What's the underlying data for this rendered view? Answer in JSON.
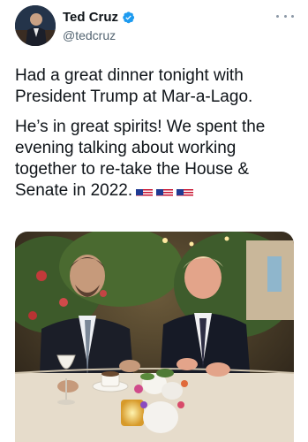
{
  "author": {
    "display_name": "Ted Cruz",
    "handle": "@tedcruz",
    "verified": true
  },
  "tweet": {
    "paragraph_1": "Had a great dinner tonight with President Trump at Mar-a-Lago.",
    "paragraph_2": "He’s in great spirits! We spent the evening talking about working together to re-take the House & Senate in 2022.",
    "emoji_flags": [
      "us-flag",
      "us-flag",
      "us-flag"
    ]
  },
  "icons": {
    "verified": "verified-badge-icon",
    "more": "more-options-icon"
  },
  "colors": {
    "verified_blue": "#1d9bf0",
    "text": "#0f1419",
    "secondary_text": "#536471"
  }
}
